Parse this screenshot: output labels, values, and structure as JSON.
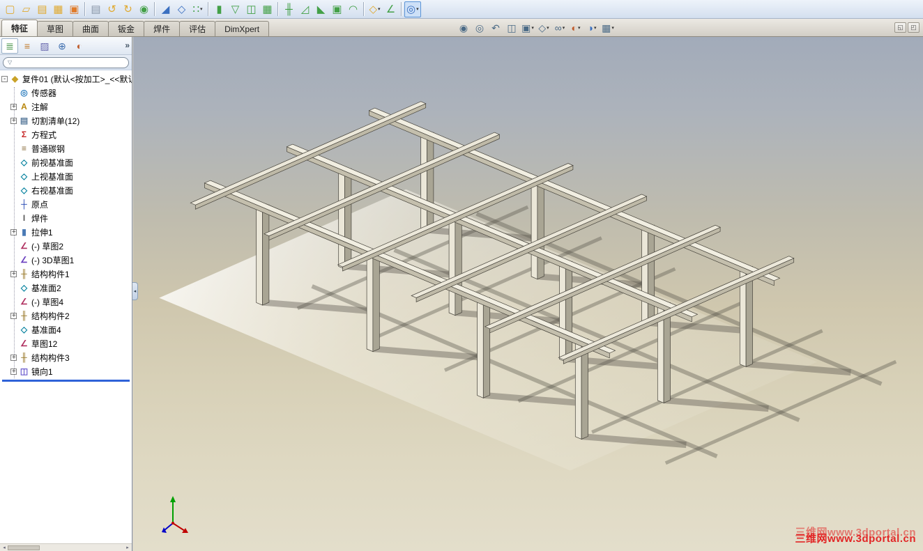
{
  "top_toolbar": {
    "items": [
      {
        "kind": "icon",
        "name": "new-document-icon",
        "glyph": "▢",
        "color": "#e0a92e"
      },
      {
        "kind": "icon",
        "name": "open-icon",
        "glyph": "▱",
        "color": "#e0a92e"
      },
      {
        "kind": "icon",
        "name": "make-drawing-icon",
        "glyph": "▤",
        "color": "#e0a92e"
      },
      {
        "kind": "icon",
        "name": "make-assembly-icon",
        "glyph": "▦",
        "color": "#e0a92e"
      },
      {
        "kind": "icon",
        "name": "save-icon",
        "glyph": "▣",
        "color": "#e07b2a"
      },
      {
        "kind": "sep"
      },
      {
        "kind": "icon",
        "name": "print-icon",
        "glyph": "▤",
        "color": "#8a97a8"
      },
      {
        "kind": "icon",
        "name": "undo-icon",
        "glyph": "↺",
        "color": "#e0a92e"
      },
      {
        "kind": "icon",
        "name": "redo-icon",
        "glyph": "↻",
        "color": "#e0a92e"
      },
      {
        "kind": "icon",
        "name": "rebuild-icon",
        "glyph": "◉",
        "color": "#43a047"
      },
      {
        "kind": "sep"
      },
      {
        "kind": "icon",
        "name": "sketch-icon",
        "glyph": "◢",
        "color": "#3a6fc0"
      },
      {
        "kind": "icon",
        "name": "smart-dimension-icon",
        "glyph": "◇",
        "color": "#3a6fc0"
      },
      {
        "kind": "icon",
        "name": "grid-system-icon",
        "glyph": "∷",
        "color": "#43a047",
        "caret": "true"
      },
      {
        "kind": "sep"
      },
      {
        "kind": "icon",
        "name": "extruded-boss-icon",
        "glyph": "▮",
        "color": "#43a047"
      },
      {
        "kind": "icon",
        "name": "extruded-cut-icon",
        "glyph": "▽",
        "color": "#43a047"
      },
      {
        "kind": "icon",
        "name": "mirror-icon",
        "glyph": "◫",
        "color": "#43a047"
      },
      {
        "kind": "icon",
        "name": "linear-pattern-icon",
        "glyph": "▦",
        "color": "#43a047"
      },
      {
        "kind": "sep"
      },
      {
        "kind": "icon",
        "name": "structural-member-icon",
        "glyph": "╫",
        "color": "#43a047"
      },
      {
        "kind": "icon",
        "name": "trim-extend-icon",
        "glyph": "◿",
        "color": "#43a047"
      },
      {
        "kind": "icon",
        "name": "gusset-icon",
        "glyph": "◣",
        "color": "#43a047"
      },
      {
        "kind": "icon",
        "name": "end-cap-icon",
        "glyph": "▣",
        "color": "#43a047"
      },
      {
        "kind": "icon",
        "name": "weld-bead-icon",
        "glyph": "◠",
        "color": "#43a047"
      },
      {
        "kind": "sep"
      },
      {
        "kind": "icon",
        "name": "reference-geometry-icon",
        "glyph": "◇",
        "color": "#e0a92e",
        "caret": "true"
      },
      {
        "kind": "icon",
        "name": "measure-icon",
        "glyph": "∠",
        "color": "#43a047"
      },
      {
        "kind": "sep"
      },
      {
        "kind": "icon",
        "name": "selection-filter-icon",
        "glyph": "◎",
        "color": "#3a6fc0",
        "caret": "true",
        "highlight": "true"
      }
    ]
  },
  "command_manager": {
    "tabs": [
      {
        "name": "tab-features",
        "label": "特征",
        "active": "true"
      },
      {
        "name": "tab-sketch",
        "label": "草图"
      },
      {
        "name": "tab-surfaces",
        "label": "曲面"
      },
      {
        "name": "tab-sheet-metal",
        "label": "钣金"
      },
      {
        "name": "tab-weldments",
        "label": "焊件"
      },
      {
        "name": "tab-evaluate",
        "label": "评估"
      },
      {
        "name": "tab-dimxpert",
        "label": "DimXpert"
      }
    ],
    "corner_buttons": [
      {
        "name": "collapse-commandmanager-button",
        "glyph": "◱"
      },
      {
        "name": "pin-commandmanager-button",
        "glyph": "◰"
      }
    ]
  },
  "view_toolbar": {
    "items": [
      {
        "name": "zoom-to-fit-icon",
        "glyph": "◉"
      },
      {
        "name": "zoom-to-area-icon",
        "glyph": "◎"
      },
      {
        "name": "previous-view-icon",
        "glyph": "↶"
      },
      {
        "name": "section-view-icon",
        "glyph": "◫"
      },
      {
        "name": "view-orientation-icon",
        "glyph": "▣",
        "caret": "true"
      },
      {
        "name": "display-style-icon",
        "glyph": "◇",
        "caret": "true"
      },
      {
        "name": "hide-show-items-icon",
        "glyph": "∞",
        "caret": "true"
      },
      {
        "name": "edit-appearance-icon",
        "glyph": "◐",
        "color": "#c05a2a",
        "caret": "true"
      },
      {
        "name": "apply-scene-icon",
        "glyph": "◑",
        "color": "#3a70c0",
        "caret": "true"
      },
      {
        "name": "view-settings-icon",
        "glyph": "▦",
        "caret": "true"
      }
    ]
  },
  "left_panel": {
    "tabs": [
      {
        "name": "featuremanager-tab",
        "glyph": "≣",
        "color": "#3f8f3f",
        "active": "true"
      },
      {
        "name": "propertymanager-tab",
        "glyph": "≡",
        "color": "#c07a2a"
      },
      {
        "name": "configurationmanager-tab",
        "glyph": "▨",
        "color": "#6a6aaf"
      },
      {
        "name": "dimxpertmanager-tab",
        "glyph": "⊕",
        "color": "#3f6faf"
      },
      {
        "name": "displaymanager-tab",
        "glyph": "◐",
        "color": "#bf5f2f"
      }
    ],
    "overflow_chevron": "»",
    "filter_value": ""
  },
  "feature_tree": {
    "items": [
      {
        "name": "tree-root",
        "label": "复件01 (默认<按加工>_<<默认",
        "glyph": "◆",
        "color": "#c9a227",
        "expander": "minus",
        "indent": "0"
      },
      {
        "name": "tree-item-sensors",
        "label": "传感器",
        "glyph": "◎",
        "color": "#2f7fbf",
        "expander": "none",
        "indent": "1"
      },
      {
        "name": "tree-item-annotations",
        "label": "注解",
        "glyph": "A",
        "color": "#b8860b",
        "expander": "plus",
        "indent": "1"
      },
      {
        "name": "tree-item-cut-list",
        "label": "切割清单(12)",
        "glyph": "▤",
        "color": "#5f7f9f",
        "expander": "plus",
        "indent": "1"
      },
      {
        "name": "tree-item-equations",
        "label": "方程式",
        "glyph": "Σ",
        "color": "#c62828",
        "expander": "none",
        "indent": "1"
      },
      {
        "name": "tree-item-material",
        "label": "普通碳钢",
        "glyph": "≡",
        "color": "#8a6d3b",
        "expander": "none",
        "indent": "1"
      },
      {
        "name": "tree-item-front-plane",
        "label": "前视基准面",
        "glyph": "◇",
        "color": "#0a84a0",
        "expander": "none",
        "indent": "1"
      },
      {
        "name": "tree-item-top-plane",
        "label": "上视基准面",
        "glyph": "◇",
        "color": "#0a84a0",
        "expander": "none",
        "indent": "1"
      },
      {
        "name": "tree-item-right-plane",
        "label": "右视基准面",
        "glyph": "◇",
        "color": "#0a84a0",
        "expander": "none",
        "indent": "1"
      },
      {
        "name": "tree-item-origin",
        "label": "原点",
        "glyph": "┼",
        "color": "#1a3faf",
        "expander": "none",
        "indent": "1"
      },
      {
        "name": "tree-item-weldment",
        "label": "焊件",
        "glyph": "I",
        "color": "#5a5a5a",
        "expander": "none",
        "indent": "1"
      },
      {
        "name": "tree-item-extrude1",
        "label": "拉伸1",
        "glyph": "▮",
        "color": "#4a7ab5",
        "expander": "plus",
        "indent": "1"
      },
      {
        "name": "tree-item-sketch2",
        "label": "(-) 草图2",
        "glyph": "∠",
        "color": "#b03060",
        "expander": "none",
        "indent": "1"
      },
      {
        "name": "tree-item-3dsketch1",
        "label": "(-) 3D草图1",
        "glyph": "∠",
        "color": "#6a3fbf",
        "expander": "none",
        "indent": "1"
      },
      {
        "name": "tree-item-structural-member1",
        "label": "结构构件1",
        "glyph": "╫",
        "color": "#9a7b2d",
        "expander": "plus",
        "indent": "1"
      },
      {
        "name": "tree-item-plane2",
        "label": "基准面2",
        "glyph": "◇",
        "color": "#0a84a0",
        "expander": "none",
        "indent": "1"
      },
      {
        "name": "tree-item-sketch4",
        "label": "(-) 草图4",
        "glyph": "∠",
        "color": "#b03060",
        "expander": "none",
        "indent": "1"
      },
      {
        "name": "tree-item-structural-member2",
        "label": "结构构件2",
        "glyph": "╫",
        "color": "#9a7b2d",
        "expander": "plus",
        "indent": "1"
      },
      {
        "name": "tree-item-plane4",
        "label": "基准面4",
        "glyph": "◇",
        "color": "#0a84a0",
        "expander": "none",
        "indent": "1"
      },
      {
        "name": "tree-item-sketch12",
        "label": "草图12",
        "glyph": "∠",
        "color": "#b03060",
        "expander": "none",
        "indent": "1"
      },
      {
        "name": "tree-item-structural-member3",
        "label": "结构构件3",
        "glyph": "╫",
        "color": "#9a7b2d",
        "expander": "plus",
        "indent": "1"
      },
      {
        "name": "tree-item-mirror1",
        "label": "镜向1",
        "glyph": "◫",
        "color": "#6a5acd",
        "expander": "plus",
        "indent": "1"
      }
    ]
  },
  "viewport": {
    "watermark": "三维网www.3dportal.cn"
  },
  "colors": {
    "rollback_bar": "#2f62d8",
    "watermark": "#e22525",
    "selection_highlight": "#5a93d6",
    "viewport_top": "#a2abba",
    "viewport_bottom": "#e3decb"
  }
}
